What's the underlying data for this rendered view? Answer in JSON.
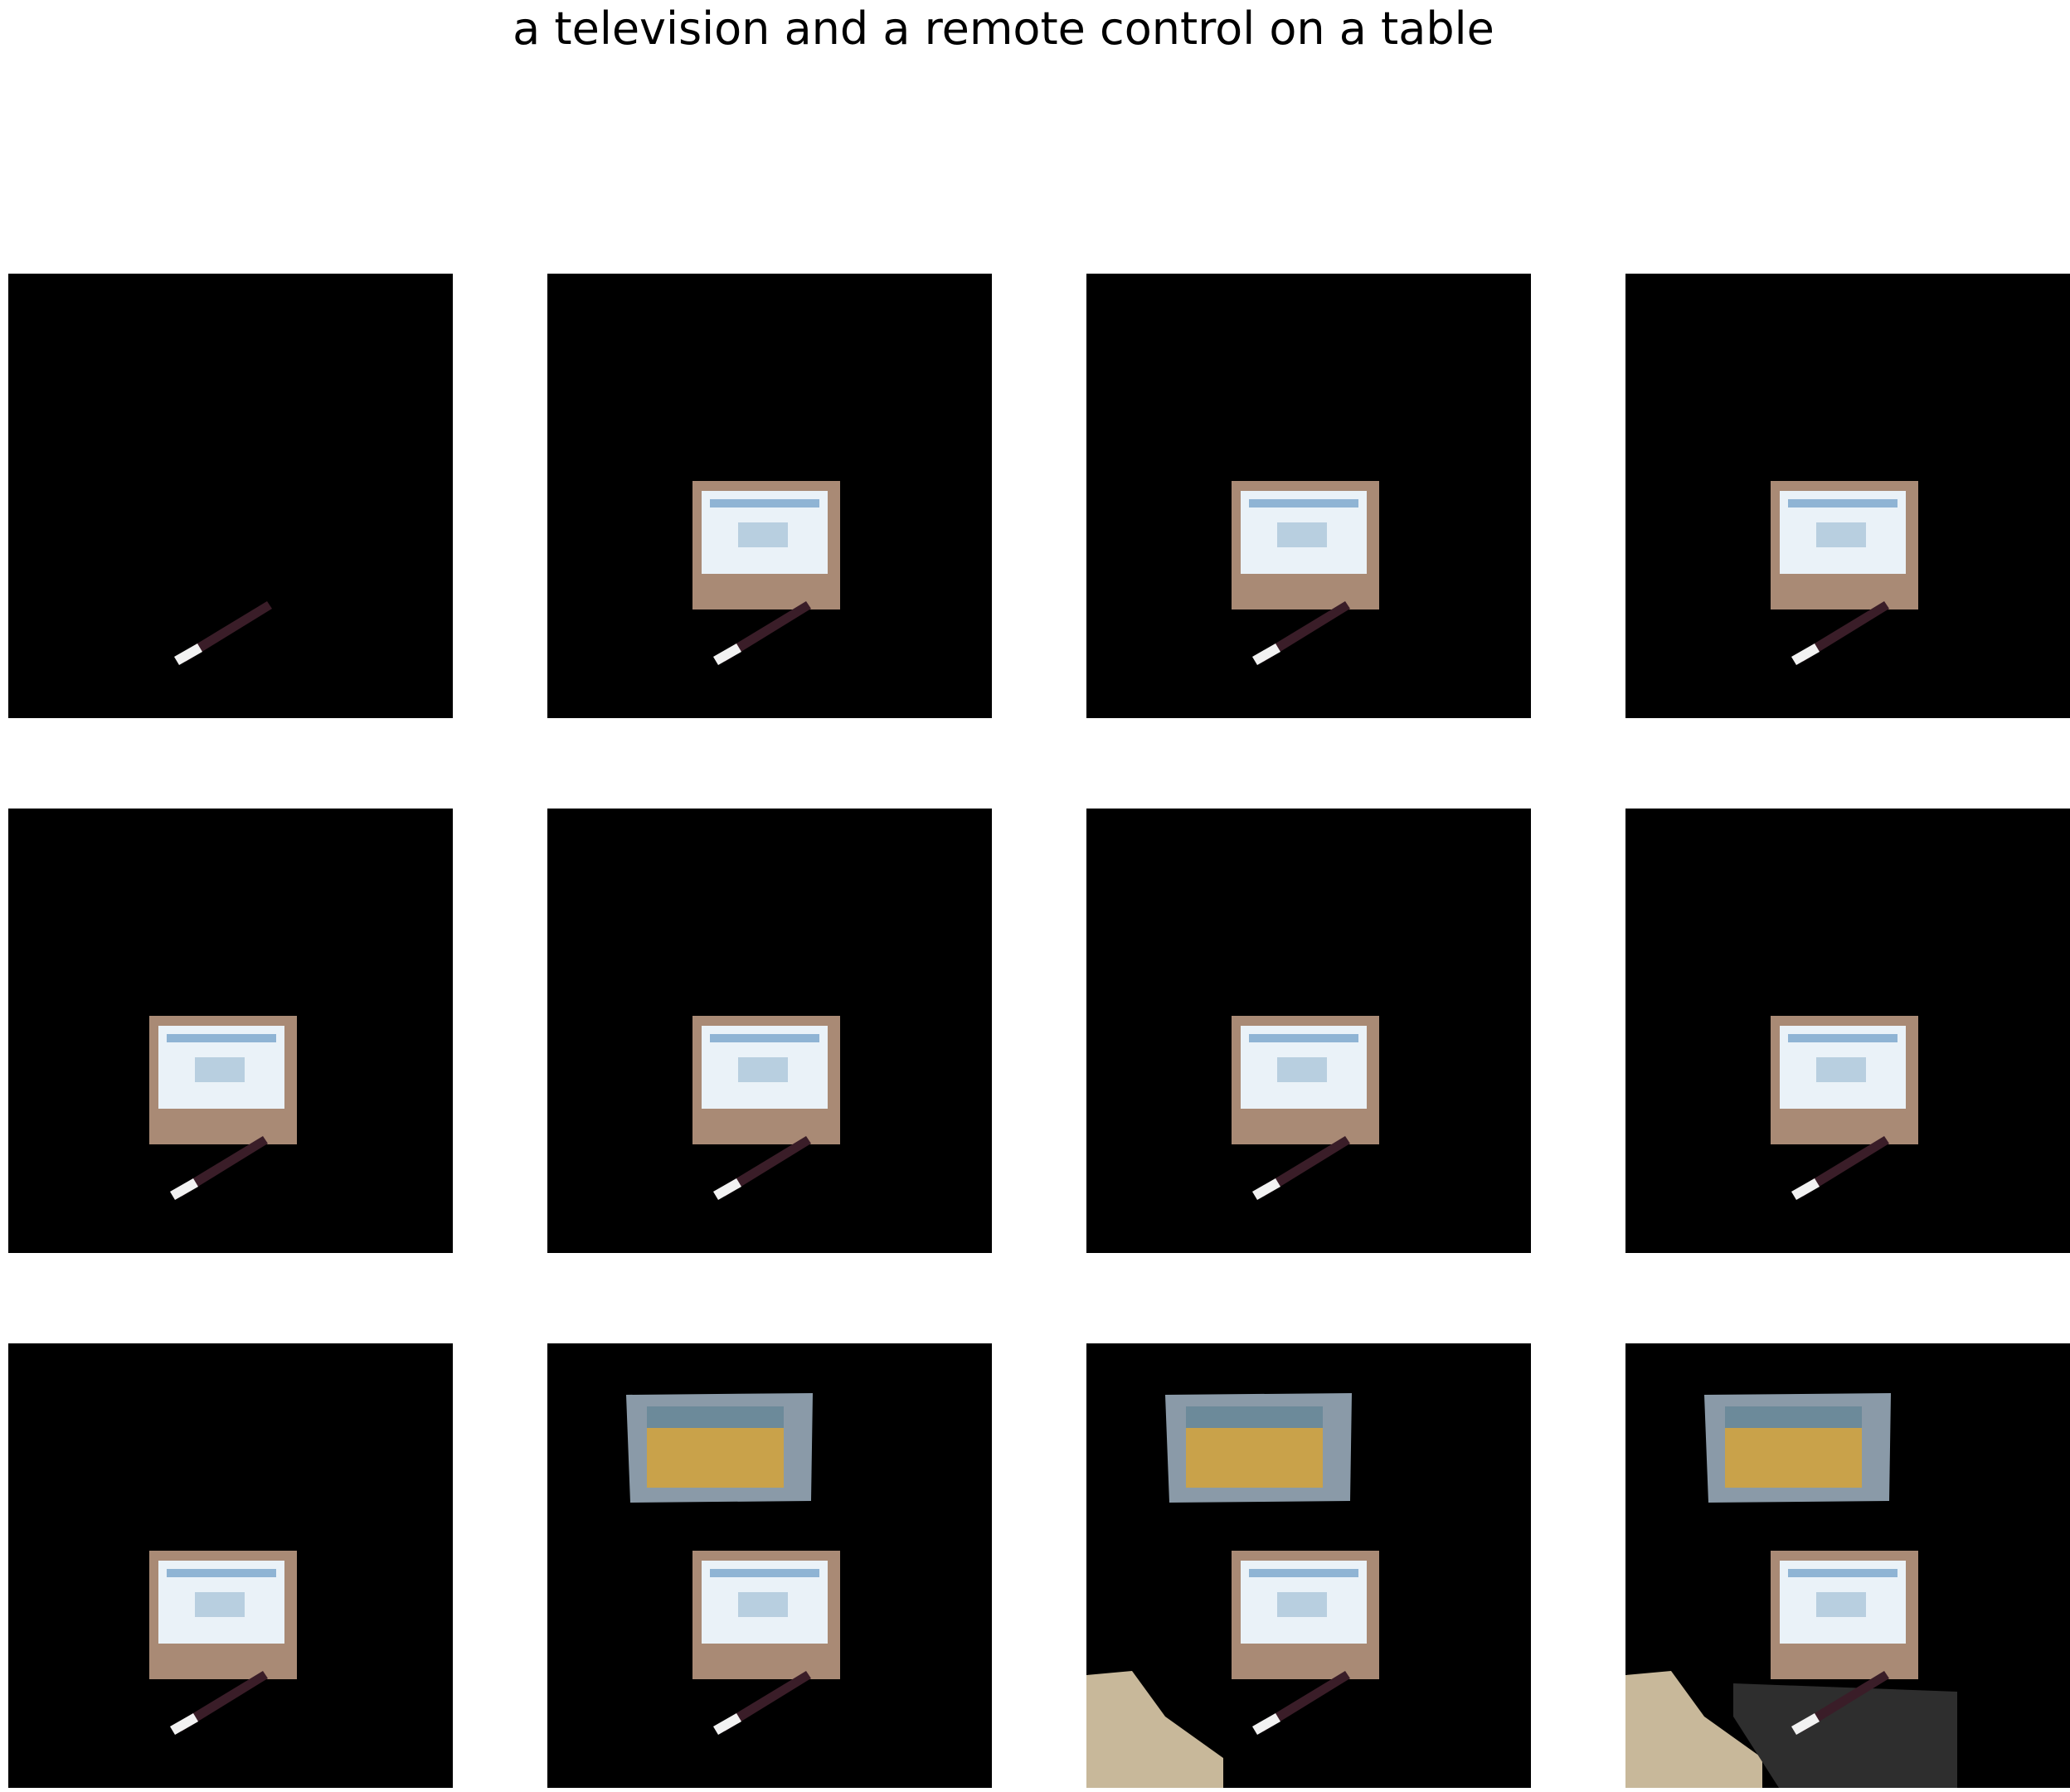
{
  "title": "a television and a remote control on a table",
  "colors": {
    "background": "#000000",
    "laptop_body": "#a98a75",
    "laptop_screen": "#eaf2f8",
    "tv_frame": "#8a9aa8",
    "tv_screen": "#c9a24a",
    "remote": "#3a1d28",
    "floor": "#c8b89a",
    "table": "#2e2e2e"
  },
  "panels": [
    {
      "step": 1,
      "objects": [
        "remote"
      ]
    },
    {
      "step": 2,
      "objects": [
        "laptop",
        "remote"
      ]
    },
    {
      "step": 3,
      "objects": [
        "laptop",
        "remote"
      ]
    },
    {
      "step": 4,
      "objects": [
        "laptop",
        "remote"
      ]
    },
    {
      "step": 5,
      "objects": [
        "laptop",
        "remote"
      ]
    },
    {
      "step": 6,
      "objects": [
        "laptop",
        "remote"
      ]
    },
    {
      "step": 7,
      "objects": [
        "laptop",
        "remote"
      ]
    },
    {
      "step": 8,
      "objects": [
        "laptop",
        "remote"
      ]
    },
    {
      "step": 9,
      "objects": [
        "laptop",
        "remote"
      ]
    },
    {
      "step": 10,
      "objects": [
        "television",
        "laptop",
        "remote"
      ]
    },
    {
      "step": 11,
      "objects": [
        "television",
        "laptop",
        "remote",
        "floor"
      ]
    },
    {
      "step": 12,
      "objects": [
        "television",
        "laptop",
        "remote",
        "floor",
        "table"
      ]
    }
  ]
}
